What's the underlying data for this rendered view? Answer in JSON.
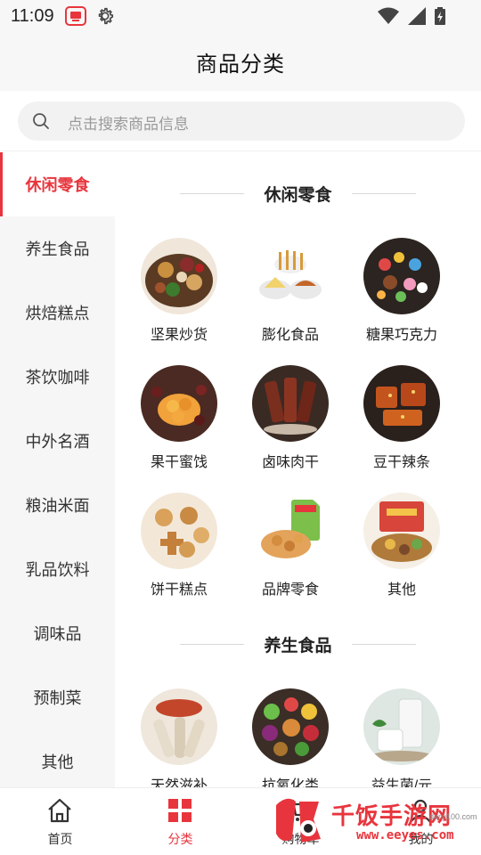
{
  "status_bar": {
    "time": "11:09",
    "icons": [
      "app-notification-icon",
      "gear-icon",
      "wifi-icon",
      "signal-icon",
      "battery-icon"
    ]
  },
  "header": {
    "title": "商品分类"
  },
  "search": {
    "placeholder": "点击搜索商品信息",
    "icon": "search-icon"
  },
  "sidebar": {
    "active_index": 0,
    "items": [
      {
        "label": "休闲零食"
      },
      {
        "label": "养生食品"
      },
      {
        "label": "烘焙糕点"
      },
      {
        "label": "茶饮咖啡"
      },
      {
        "label": "中外名酒"
      },
      {
        "label": "粮油米面"
      },
      {
        "label": "乳品饮料"
      },
      {
        "label": "调味品"
      },
      {
        "label": "预制菜"
      },
      {
        "label": "其他"
      }
    ]
  },
  "sections": [
    {
      "title": "休闲零食",
      "items": [
        {
          "label": "坚果炒货"
        },
        {
          "label": "膨化食品"
        },
        {
          "label": "糖果巧克力"
        },
        {
          "label": "果干蜜饯"
        },
        {
          "label": "卤味肉干"
        },
        {
          "label": "豆干辣条"
        },
        {
          "label": "饼干糕点"
        },
        {
          "label": "品牌零食"
        },
        {
          "label": "其他"
        }
      ]
    },
    {
      "title": "养生食品",
      "items": [
        {
          "label": "天然滋补"
        },
        {
          "label": "抗氧化类"
        },
        {
          "label": "益生菌/元"
        }
      ]
    }
  ],
  "bottom_nav": {
    "active_index": 1,
    "items": [
      {
        "label": "首页",
        "icon": "home-icon"
      },
      {
        "label": "分类",
        "icon": "category-grid-icon"
      },
      {
        "label": "购物车",
        "icon": "cart-icon"
      },
      {
        "label": "我的",
        "icon": "profile-icon"
      }
    ]
  },
  "watermark": {
    "text": "千饭手游网",
    "url": "www.eeyes.com",
    "sub": "danji100.com"
  },
  "colors": {
    "accent": "#e8353d",
    "sidebar_bg": "#f6f6f6",
    "header_bg": "#f7f7f7"
  }
}
